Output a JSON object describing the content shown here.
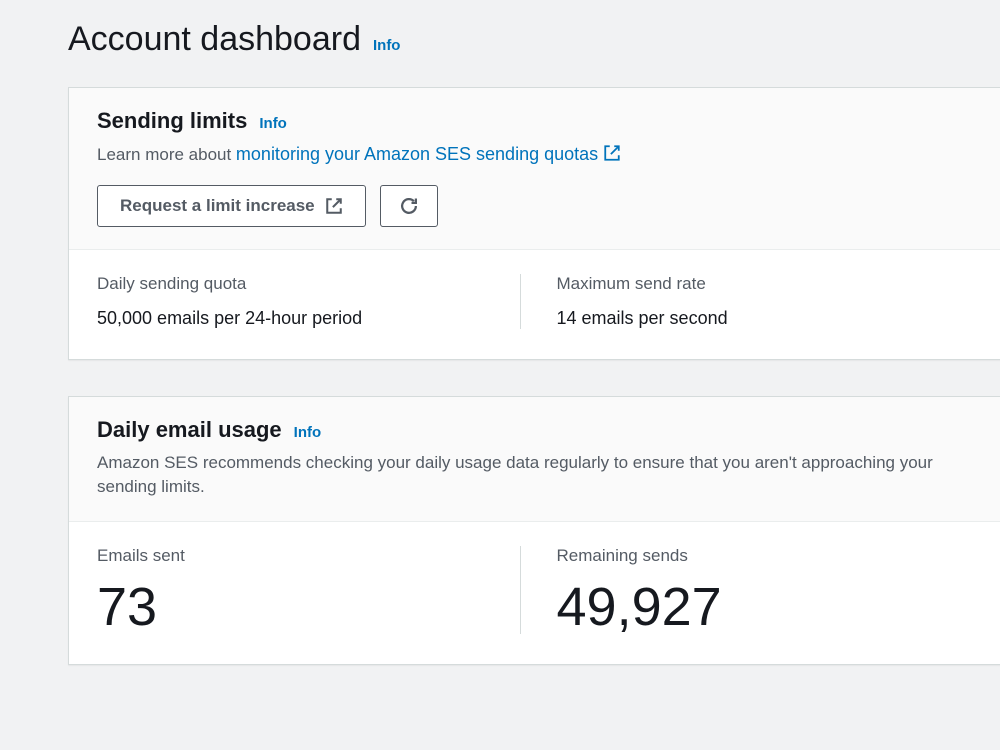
{
  "page": {
    "title": "Account dashboard",
    "info_label": "Info"
  },
  "sending_limits": {
    "title": "Sending limits",
    "info_label": "Info",
    "desc_prefix": "Learn more about ",
    "desc_link": "monitoring your Amazon SES sending quotas",
    "request_button": "Request a limit increase",
    "quota_label": "Daily sending quota",
    "quota_value": "50,000 emails per 24-hour period",
    "rate_label": "Maximum send rate",
    "rate_value": "14 emails per second"
  },
  "daily_usage": {
    "title": "Daily email usage",
    "info_label": "Info",
    "desc": "Amazon SES recommends checking your daily usage data regularly to ensure that you aren't approaching your sending limits.",
    "sent_label": "Emails sent",
    "sent_value": "73",
    "remaining_label": "Remaining sends",
    "remaining_value": "49,927"
  }
}
